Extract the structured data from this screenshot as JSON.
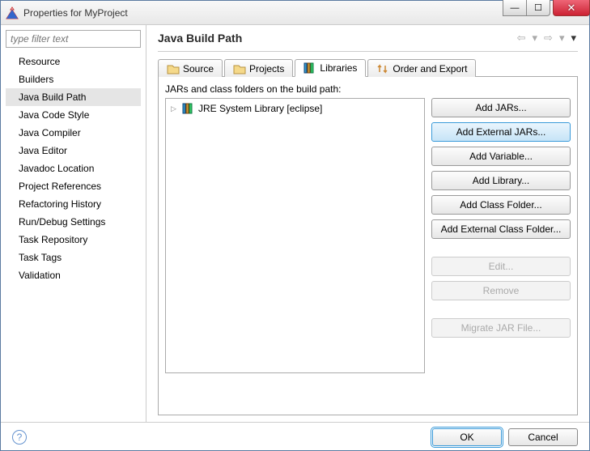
{
  "window": {
    "title": "Properties for MyProject"
  },
  "filter": {
    "placeholder": "type filter text"
  },
  "nav": {
    "items": [
      {
        "label": "Resource"
      },
      {
        "label": "Builders"
      },
      {
        "label": "Java Build Path",
        "selected": true
      },
      {
        "label": "Java Code Style"
      },
      {
        "label": "Java Compiler"
      },
      {
        "label": "Java Editor"
      },
      {
        "label": "Javadoc Location"
      },
      {
        "label": "Project References"
      },
      {
        "label": "Refactoring History"
      },
      {
        "label": "Run/Debug Settings"
      },
      {
        "label": "Task Repository"
      },
      {
        "label": "Task Tags"
      },
      {
        "label": "Validation"
      }
    ]
  },
  "page": {
    "heading": "Java Build Path",
    "tabs": [
      {
        "label": "Source"
      },
      {
        "label": "Projects"
      },
      {
        "label": "Libraries",
        "active": true
      },
      {
        "label": "Order and Export"
      }
    ],
    "section_label": "JARs and class folders on the build path:",
    "tree": [
      {
        "label": "JRE System Library [eclipse]"
      }
    ],
    "buttons": [
      {
        "label": "Add JARs...",
        "enabled": true
      },
      {
        "label": "Add External JARs...",
        "enabled": true,
        "highlight": true
      },
      {
        "label": "Add Variable...",
        "enabled": true
      },
      {
        "label": "Add Library...",
        "enabled": true
      },
      {
        "label": "Add Class Folder...",
        "enabled": true
      },
      {
        "label": "Add External Class Folder...",
        "enabled": true
      },
      {
        "label": "Edit...",
        "enabled": false
      },
      {
        "label": "Remove",
        "enabled": false
      },
      {
        "label": "Migrate JAR File...",
        "enabled": false
      }
    ]
  },
  "footer": {
    "ok": "OK",
    "cancel": "Cancel"
  }
}
